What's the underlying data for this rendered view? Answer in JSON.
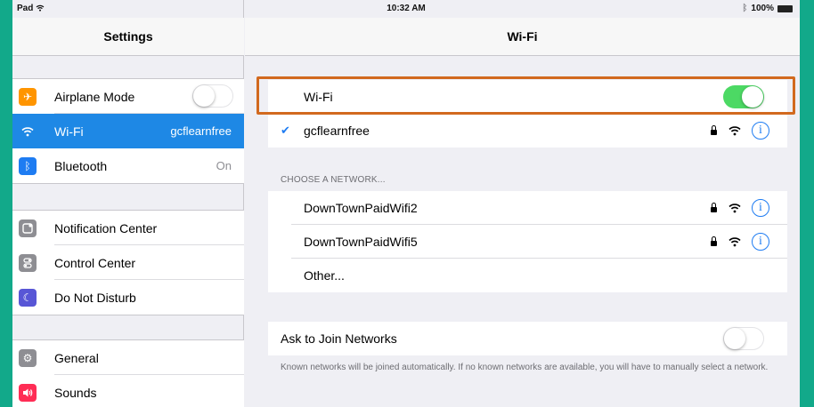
{
  "status_bar": {
    "carrier": "Pad",
    "time": "10:32 AM",
    "battery": "100%"
  },
  "sidebar": {
    "title": "Settings",
    "group1": [
      {
        "label": "Airplane Mode",
        "icon": "airplane-icon",
        "color": "#ff9500",
        "toggle": "off"
      },
      {
        "label": "Wi-Fi",
        "value": "gcflearnfree",
        "icon": "wifi-icon",
        "color": "#1e88e5",
        "selected": true
      },
      {
        "label": "Bluetooth",
        "value": "On",
        "icon": "bluetooth-icon",
        "color": "#1e7cf2"
      }
    ],
    "group2": [
      {
        "label": "Notification Center",
        "icon": "notification-icon",
        "color": "#8e8e93"
      },
      {
        "label": "Control Center",
        "icon": "control-center-icon",
        "color": "#8e8e93"
      },
      {
        "label": "Do Not Disturb",
        "icon": "moon-icon",
        "color": "#5856d6"
      }
    ],
    "group3": [
      {
        "label": "General",
        "icon": "gear-icon",
        "color": "#8e8e93"
      },
      {
        "label": "Sounds",
        "icon": "speaker-icon",
        "color": "#ff2d55"
      }
    ]
  },
  "main": {
    "title": "Wi-Fi",
    "wifi_label": "Wi-Fi",
    "wifi_toggle": "on",
    "connected_network": "gcflearnfree",
    "choose_label": "CHOOSE A NETWORK...",
    "networks": [
      {
        "name": "DownTownPaidWifi2",
        "locked": true
      },
      {
        "name": "DownTownPaidWifi5",
        "locked": true
      },
      {
        "name": "Other..."
      }
    ],
    "ask_to_join_label": "Ask to Join Networks",
    "ask_to_join_toggle": "off",
    "ask_to_join_note": "Known networks will be joined automatically. If no known networks are available, you will have to manually select a network."
  },
  "colors": {
    "accent": "#1e7cf2",
    "toggle_on": "#4cd964",
    "highlight": "#d2691e",
    "background": "#12a98a"
  }
}
